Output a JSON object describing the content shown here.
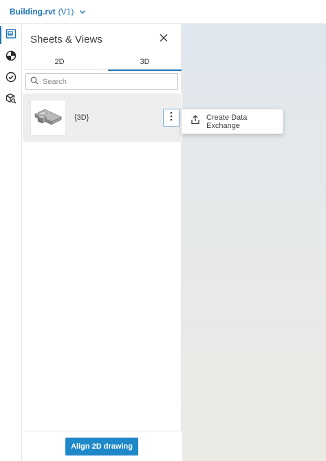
{
  "header": {
    "file_name": "Building.rvt",
    "version": "(V1)",
    "chevron_icon": "chevron-down-icon"
  },
  "rail": {
    "items": [
      {
        "icon": "sheets-views-icon",
        "active": true
      },
      {
        "icon": "model-browser-icon",
        "active": false
      },
      {
        "icon": "checkmark-circle-icon",
        "active": false
      },
      {
        "icon": "cube-search-icon",
        "active": false
      }
    ]
  },
  "panel": {
    "title": "Sheets & Views",
    "tabs": [
      {
        "label": "2D",
        "active": false
      },
      {
        "label": "3D",
        "active": true
      }
    ],
    "search": {
      "placeholder": "Search",
      "value": ""
    },
    "views": [
      {
        "label": "{3D}"
      }
    ],
    "footer_button": "Align 2D drawing"
  },
  "context_menu": {
    "items": [
      {
        "label": "Create Data Exchange",
        "icon": "share-upload-icon"
      }
    ]
  },
  "colors": {
    "accent": "#1e73b8",
    "button": "#1e88c9"
  }
}
